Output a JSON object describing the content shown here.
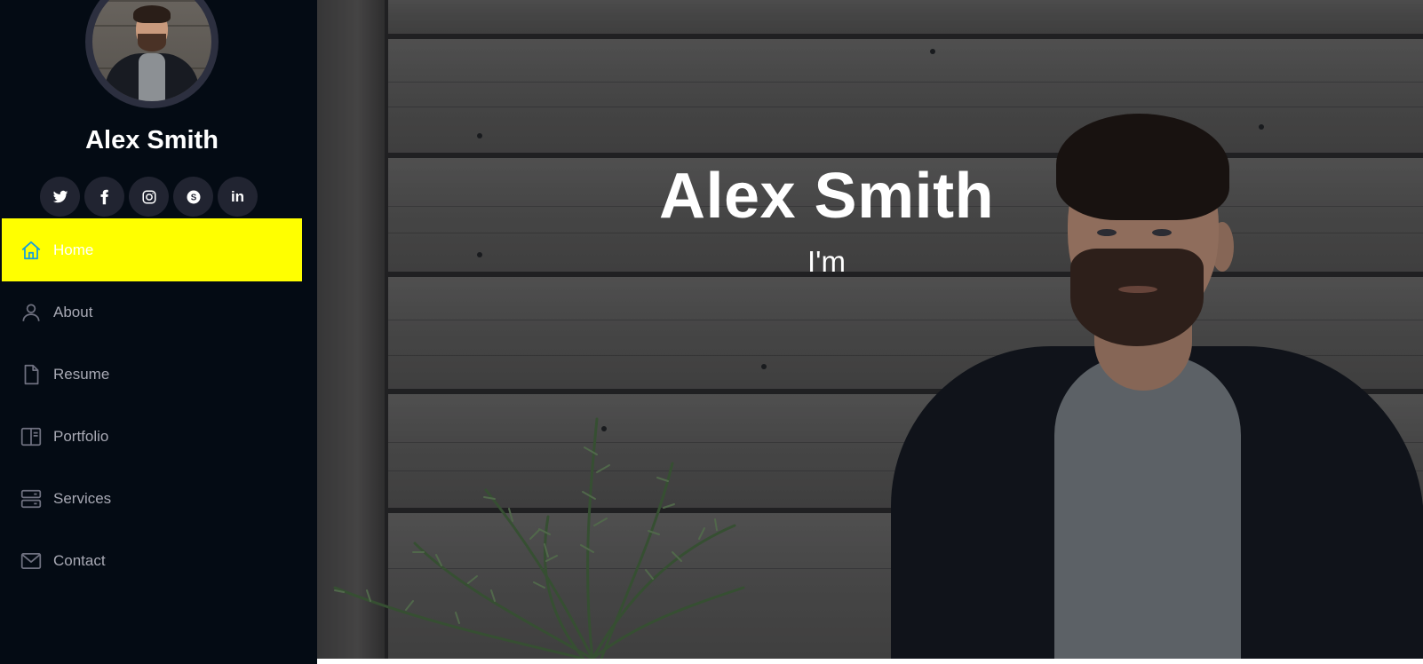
{
  "profile": {
    "name": "Alex Smith",
    "avatar": "profile-photo"
  },
  "socials": [
    {
      "name": "twitter",
      "icon": "twitter-icon"
    },
    {
      "name": "facebook",
      "icon": "facebook-icon"
    },
    {
      "name": "instagram",
      "icon": "instagram-icon"
    },
    {
      "name": "skype",
      "icon": "skype-icon"
    },
    {
      "name": "linkedin",
      "icon": "linkedin-icon"
    }
  ],
  "nav": {
    "items": [
      {
        "label": "Home",
        "icon": "home-icon",
        "active": true
      },
      {
        "label": "About",
        "icon": "person-icon",
        "active": false
      },
      {
        "label": "Resume",
        "icon": "file-icon",
        "active": false
      },
      {
        "label": "Portfolio",
        "icon": "book-icon",
        "active": false
      },
      {
        "label": "Services",
        "icon": "server-icon",
        "active": false
      },
      {
        "label": "Contact",
        "icon": "envelope-icon",
        "active": false
      }
    ]
  },
  "hero": {
    "title": "Alex Smith",
    "subtitle": "I'm"
  },
  "colors": {
    "sidebar_bg": "#040b14",
    "active_nav_bg": "#ffff00",
    "active_icon": "#149ddd",
    "nav_text": "#a8a9b4",
    "social_bg": "#212431"
  }
}
